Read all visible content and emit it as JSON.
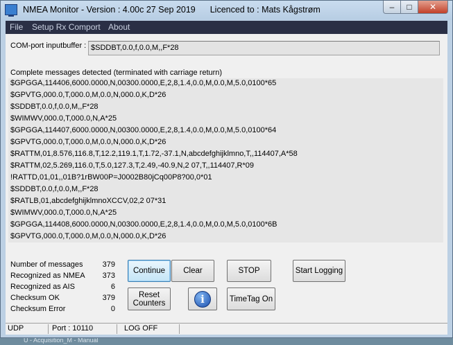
{
  "window": {
    "title": "NMEA Monitor - Version : 4.00c 27 Sep 2019",
    "licence": "Licenced to : Mats Kågstrøm",
    "min_glyph": "–",
    "max_glyph": "□",
    "close_glyph": "✕"
  },
  "menu": {
    "items": [
      "File",
      "Setup Rx Comport",
      "About"
    ]
  },
  "input": {
    "label": "COM-port inputbuffer :",
    "value": "$SDDBT,0.0,f,0.0,M,,F*28"
  },
  "messages": {
    "header": "Complete messages detected (terminated with carriage return)",
    "lines": [
      "$GPGGA,114406,6000.0000,N,00300.0000,E,2,8,1.4,0.0,M,0.0,M,5.0,0100*65",
      "$GPVTG,000.0,T,000.0,M,0.0,N,000.0,K,D*26",
      "$SDDBT,0.0,f,0.0,M,,F*28",
      "$WIMWV,000.0,T,000.0,N,A*25",
      "$GPGGA,114407,6000.0000,N,00300.0000,E,2,8,1.4,0.0,M,0.0,M,5.0,0100*64",
      "$GPVTG,000.0,T,000.0,M,0.0,N,000.0,K,D*26",
      "$RATTM,01,8.576,116.8,T,12.2,119.1,T,1.72,-37.1,N,abcdefghijklmno,T,,114407,A*58",
      "$RATTM,02,5.269,116.0,T,5.0,127.3,T,2.49,-40.9,N,2 07,T,,114407,R*09",
      "!RATTD,01,01,,01B?1rBW00P=J0002B80jCq00P8?00,0*01",
      "$SDDBT,0.0,f,0.0,M,,F*28",
      "$RATLB,01,abcdefghijklmnoXCCV,02,2 07*31",
      "$WIMWV,000.0,T,000.0,N,A*25",
      "$GPGGA,114408,6000.0000,N,00300.0000,E,2,8,1.4,0.0,M,0.0,M,5.0,0100*6B",
      "$GPVTG,000.0,T,000.0,M,0.0,N,000.0,K,D*26"
    ]
  },
  "stats": [
    {
      "label": "Number of messages",
      "value": "379"
    },
    {
      "label": "Recognized as NMEA",
      "value": "373"
    },
    {
      "label": "Recognized as AIS",
      "value": "6"
    },
    {
      "label": "Checksum OK",
      "value": "379"
    },
    {
      "label": "Checksum Error",
      "value": "0"
    }
  ],
  "buttons": {
    "continue": "Continue",
    "clear": "Clear",
    "stop": "STOP",
    "start_logging": "Start Logging",
    "reset_counters": "Reset\nCounters",
    "info": "i",
    "timetag": "TimeTag On"
  },
  "status": {
    "protocol": "UDP",
    "port": "Port : 10110",
    "log": "LOG OFF"
  },
  "background_window": {
    "text": "U - Acquisition_M - Manual"
  }
}
